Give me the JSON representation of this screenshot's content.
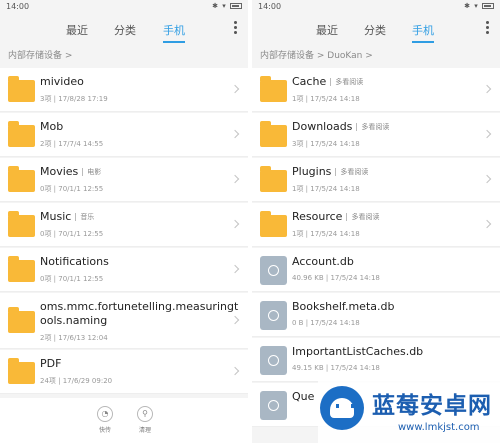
{
  "status": {
    "time": "14:00"
  },
  "tabs": [
    "最近",
    "分类",
    "手机"
  ],
  "active_tab": "手机",
  "left": {
    "breadcrumb": "内部存储设备 >",
    "items": [
      {
        "name": "mivideo",
        "tag": "",
        "meta": "3项 | 17/8/28 17:19",
        "icon": "folder-icon"
      },
      {
        "name": "Mob",
        "tag": "",
        "meta": "2项 | 17/7/4 14:55",
        "icon": "folder-icon"
      },
      {
        "name": "Movies",
        "tag": "电影",
        "meta": "0项 | 70/1/1 12:55",
        "icon": "folder-icon"
      },
      {
        "name": "Music",
        "tag": "音乐",
        "meta": "0项 | 70/1/1 12:55",
        "icon": "folder-icon"
      },
      {
        "name": "Notifications",
        "tag": "",
        "meta": "0项 | 70/1/1 12:55",
        "icon": "folder-icon"
      },
      {
        "name": "oms.mmc.fortunetelling.measuringtools.naming",
        "name_line1": "oms.mmc.fortunetelling.measuringt",
        "name_line2": "ools.naming",
        "tag": "",
        "meta": "2项 | 17/6/13 12:04",
        "icon": "folder-icon"
      },
      {
        "name": "PDF",
        "tag": "",
        "meta": "24项 | 17/6/29 09:20",
        "icon": "folder-icon"
      }
    ],
    "bottom": {
      "cut_label": "快传",
      "clean_label": "清理"
    }
  },
  "right": {
    "breadcrumb": "内部存储设备 > DuoKan >",
    "items": [
      {
        "name": "Cache",
        "tag": "多看阅读",
        "meta": "1项 | 17/5/24 14:18",
        "icon": "folder-icon"
      },
      {
        "name": "Downloads",
        "tag": "多看阅读",
        "meta": "3项 | 17/5/24 14:18",
        "icon": "folder-icon"
      },
      {
        "name": "Plugins",
        "tag": "多看阅读",
        "meta": "1项 | 17/5/24 14:18",
        "icon": "folder-icon"
      },
      {
        "name": "Resource",
        "tag": "多看阅读",
        "meta": "1项 | 17/5/24 14:18",
        "icon": "folder-icon"
      },
      {
        "name": "Account.db",
        "tag": "",
        "meta": "40.96 KB | 17/5/24 14:18",
        "icon": "file-icon"
      },
      {
        "name": "Bookshelf.meta.db",
        "tag": "",
        "meta": "0 B | 17/5/24 14:18",
        "icon": "file-icon"
      },
      {
        "name": "ImportantListCaches.db",
        "tag": "",
        "meta": "49.15 KB | 17/5/24 14:18",
        "icon": "file-icon"
      },
      {
        "name": "Que",
        "tag": "",
        "meta": "",
        "icon": "file-icon"
      }
    ]
  },
  "watermark": {
    "title": "蓝莓安卓网",
    "url": "www.lmkjst.com"
  },
  "colors": {
    "accent": "#2f9de3",
    "folder": "#f9b938",
    "file": "#a9b7c4",
    "watermark": "#1c5eb0"
  }
}
